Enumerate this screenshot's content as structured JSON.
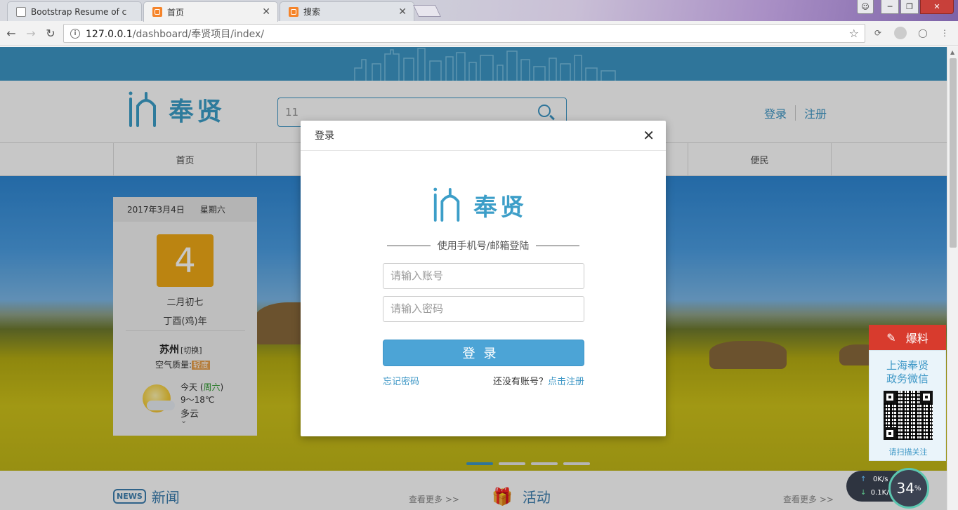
{
  "browser": {
    "tabs": [
      {
        "title": "Bootstrap Resume of c",
        "active": false
      },
      {
        "title": "首页",
        "active": true
      },
      {
        "title": "搜索",
        "active": false
      }
    ],
    "url_host": "127.0.0.1",
    "url_path": "/dashboard/奉贤项目/index/"
  },
  "site": {
    "logo_text": "奉贤",
    "search_value": "11",
    "login_link": "登录",
    "register_link": "注册",
    "nav": [
      "首页",
      "便民"
    ]
  },
  "calendar": {
    "date": "2017年3月4日",
    "weekday": "星期六",
    "day": "4",
    "lunar_date": "二月初七",
    "lunar_year": "丁酉(鸡)年",
    "city": "苏州",
    "switch": "[切换]",
    "aq_label": "空气质量:",
    "aq_value": "轻度",
    "today_prefix": "今天 (",
    "today_day": "周六",
    "today_suffix": ")",
    "temp": "9～18℃",
    "weather": "多云"
  },
  "sections": {
    "news_icon": "NEWS",
    "news": "新闻",
    "activities": "活动",
    "more": "查看更多 >>"
  },
  "sidebar": {
    "baoliao": "爆料",
    "wechat_title_1": "上海奉贤",
    "wechat_title_2": "政务微信",
    "scan": "请扫描关注"
  },
  "speed_widget": {
    "up": "0",
    "up_unit": "K/s",
    "down": "0.1",
    "down_unit": "K/s",
    "percent": "34",
    "percent_unit": "%"
  },
  "modal": {
    "title": "登录",
    "logo_text": "奉贤",
    "divider_text": "使用手机号/邮箱登陆",
    "account_placeholder": "请输入账号",
    "password_placeholder": "请输入密码",
    "login_button": "登录",
    "forgot_password": "忘记密码",
    "no_account": "还没有账号？",
    "register_link": "点击注册"
  },
  "colors": {
    "brand": "#3d97c6",
    "alert": "#d83b2d",
    "calendar_day": "#f0a917"
  }
}
